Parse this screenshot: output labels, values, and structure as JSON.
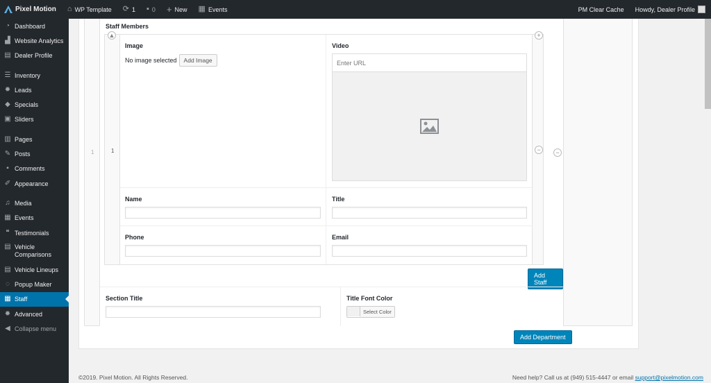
{
  "adminbar": {
    "site_name": "Pixel Motion",
    "template": "WP Template",
    "updates_count": "1",
    "comments_count": "0",
    "new_label": "New",
    "events_label": "Events",
    "clear_cache": "PM Clear Cache",
    "howdy": "Howdy, Dealer Profile"
  },
  "sidebar": {
    "items": [
      {
        "label": "Dashboard",
        "icon": "gauge-icon"
      },
      {
        "label": "Website Analytics",
        "icon": "analytics-icon"
      },
      {
        "label": "Dealer Profile",
        "icon": "profile-icon"
      },
      {
        "label": "Inventory",
        "icon": "inventory-icon"
      },
      {
        "label": "Leads",
        "icon": "gear-icon"
      },
      {
        "label": "Specials",
        "icon": "tag-icon"
      },
      {
        "label": "Sliders",
        "icon": "slides-icon"
      },
      {
        "label": "Pages",
        "icon": "pages-icon"
      },
      {
        "label": "Posts",
        "icon": "pin-icon"
      },
      {
        "label": "Comments",
        "icon": "comment-icon"
      },
      {
        "label": "Appearance",
        "icon": "brush-icon"
      },
      {
        "label": "Media",
        "icon": "media-icon"
      },
      {
        "label": "Events",
        "icon": "calendar-icon"
      },
      {
        "label": "Testimonials",
        "icon": "quote-icon"
      },
      {
        "label": "Vehicle Comparisons",
        "icon": "compare-icon"
      },
      {
        "label": "Vehicle Lineups",
        "icon": "list-icon"
      },
      {
        "label": "Popup Maker",
        "icon": "popup-icon"
      },
      {
        "label": "Staff",
        "icon": "staff-icon"
      },
      {
        "label": "Advanced",
        "icon": "gear-icon"
      },
      {
        "label": "Collapse menu",
        "icon": "collapse-icon"
      }
    ]
  },
  "main": {
    "staff_members_label": "Staff Members",
    "outer_row_number": "1",
    "inner_row_number": "1",
    "image_label": "Image",
    "no_image_text": "No image selected",
    "add_image_button": "Add Image",
    "video_label": "Video",
    "video_placeholder": "Enter URL",
    "name_label": "Name",
    "name_value": "",
    "title_label": "Title",
    "title_value": "",
    "phone_label": "Phone",
    "phone_value": "",
    "email_label": "Email",
    "email_value": "",
    "add_staff_button": "Add Staff",
    "section_title_label": "Section Title",
    "section_title_value": "",
    "title_font_color_label": "Title Font Color",
    "select_color_button": "Select Color",
    "add_department_button": "Add Department"
  },
  "footer": {
    "copyright": "©2019. Pixel Motion. All Rights Reserved.",
    "help_text": "Need help? Call us at (949) 515-4447 or email ",
    "email_link": "support@pixelmotion.com"
  },
  "colors": {
    "admin_dark": "#23282d",
    "accent": "#0073aa",
    "primary_button": "#0085ba"
  }
}
